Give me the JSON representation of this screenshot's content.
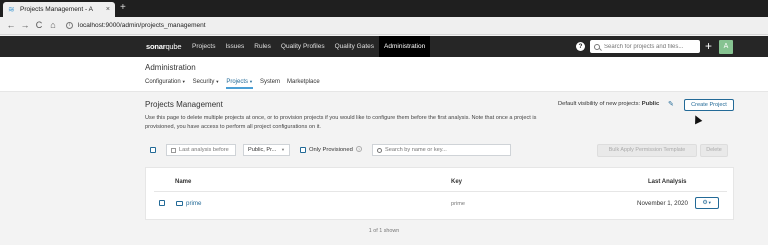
{
  "browser": {
    "tab_title": "Projects Management - A",
    "tab_close": "×",
    "new_tab": "+",
    "url": "localhost:9000/admin/projects_management",
    "back": "←",
    "forward": "→",
    "reload": "C",
    "home": "⌂"
  },
  "sonar": {
    "logo_main": "sonar",
    "logo_accent": "qube",
    "menu": [
      "Projects",
      "Issues",
      "Rules",
      "Quality Profiles",
      "Quality Gates",
      "Administration"
    ],
    "active_menu_index": 5,
    "help": "?",
    "search_placeholder": "Search for projects and files...",
    "plus": "+",
    "avatar": "A"
  },
  "admin": {
    "title": "Administration",
    "subnav": [
      {
        "label": "Configuration",
        "has_caret": true
      },
      {
        "label": "Security",
        "has_caret": true
      },
      {
        "label": "Projects",
        "has_caret": true
      },
      {
        "label": "System",
        "has_caret": false
      },
      {
        "label": "Marketplace",
        "has_caret": false
      }
    ],
    "caret": "▼"
  },
  "page": {
    "title": "Projects Management",
    "description": "Use this page to delete multiple projects at once, or to provision projects if you would like to configure them before the first analysis. Note that once a project is provisioned, you have access to perform all project configurations on it.",
    "visibility_label": "Default visibility of new projects:",
    "visibility_value": "Public",
    "create_button": "Create Project"
  },
  "filters": {
    "date_placeholder": "Last analysis before",
    "visibility_select": "Public, Pr...",
    "only_provisioned": "Only Provisioned",
    "search_placeholder": "Search by name or key...",
    "bulk_button": "Bulk Apply Permission Template",
    "delete_button": "Delete"
  },
  "table": {
    "headers": {
      "name": "Name",
      "key": "Key",
      "last_analysis": "Last Analysis"
    },
    "rows": [
      {
        "name": "prime",
        "key": "prime",
        "last_analysis": "November 1, 2020"
      }
    ],
    "shown": "1 of 1 shown"
  },
  "colors": {
    "accent": "#236a97",
    "nav_bg": "#262626",
    "avatar_bg": "#86c391"
  }
}
